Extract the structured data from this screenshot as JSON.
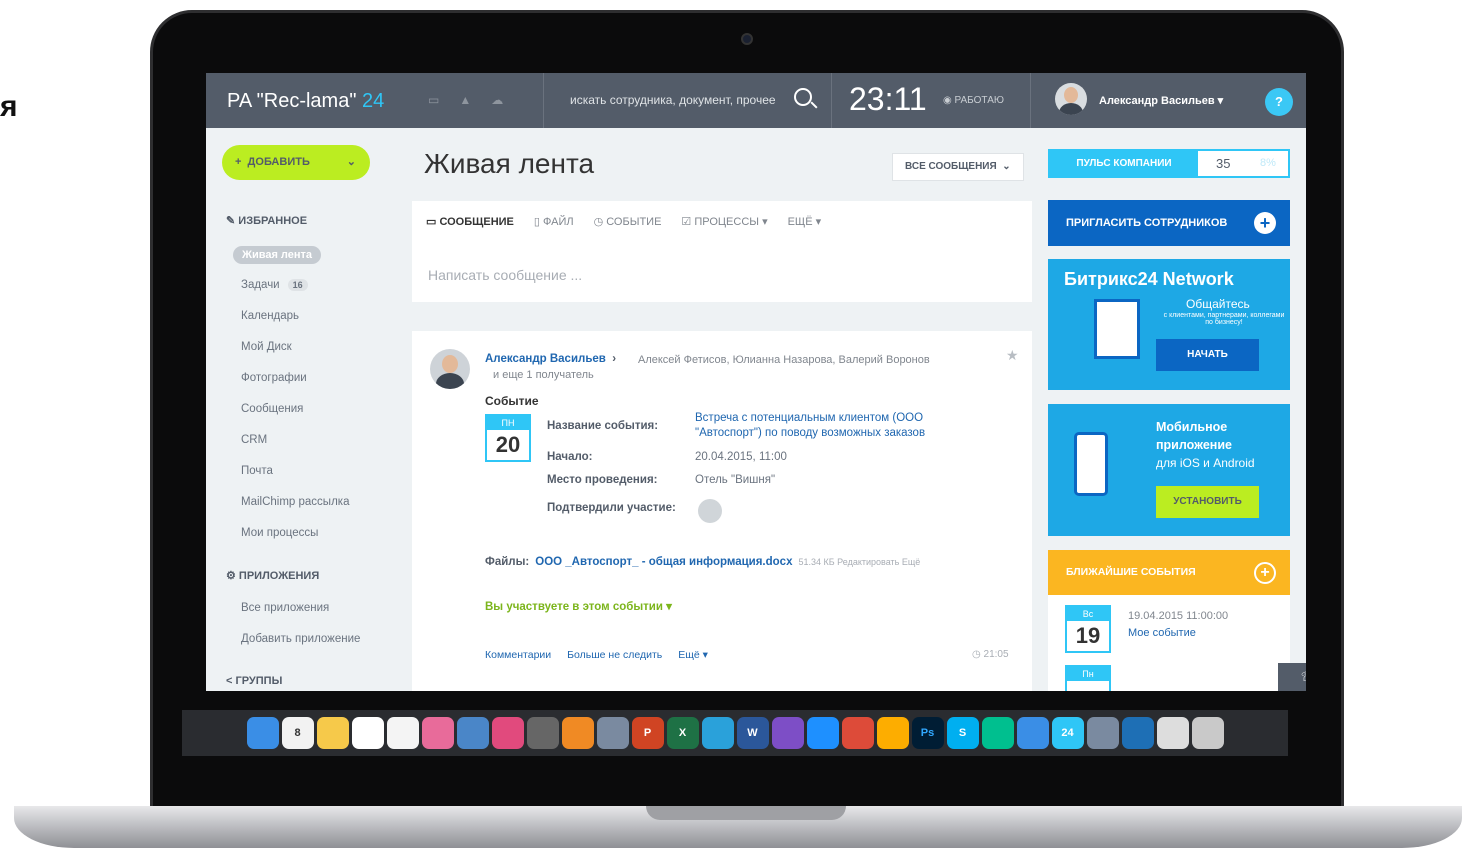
{
  "edge_text": "я",
  "topbar": {
    "brand": "PA \"Rec-lama\"",
    "brand_num": "24",
    "search_placeholder": "искать сотрудника, документ, прочее",
    "clock": "23:11",
    "status": "РАБОТАЮ",
    "user": "Александр Васильев",
    "help": "?"
  },
  "sidebar": {
    "add_label": "ДОБАВИТЬ",
    "favorites": "ИЗБРАННОЕ",
    "active_item": "Живая лента",
    "items": [
      {
        "label": "Задачи",
        "badge": "16"
      },
      {
        "label": "Календарь"
      },
      {
        "label": "Мой Диск"
      },
      {
        "label": "Фотографии"
      },
      {
        "label": "Сообщения"
      },
      {
        "label": "CRM"
      },
      {
        "label": "Почта"
      },
      {
        "label": "MailChimp рассылка"
      },
      {
        "label": "Мои процессы"
      }
    ],
    "apps_head": "ПРИЛОЖЕНИЯ",
    "apps_items": [
      "Все приложения",
      "Добавить приложение"
    ],
    "groups_head": "ГРУППЫ"
  },
  "main": {
    "title": "Живая лента",
    "filter": "ВСЕ СООБЩЕНИЯ",
    "tabs": [
      "СООБЩЕНИЕ",
      "ФАЙЛ",
      "СОБЫТИЕ",
      "ПРОЦЕССЫ",
      "ЕЩЁ"
    ],
    "placeholder": "Написать сообщение ..."
  },
  "post": {
    "author": "Александр Васильев",
    "recipients": "Алексей Фетисов, Юлианна Назарова, Валерий Воронов",
    "recipients_more": "и еще 1 получатель",
    "type": "Событие",
    "cal_dow": "ПН",
    "cal_day": "20",
    "name_label": "Название события:",
    "name_value": "Встреча с потенциальным клиентом (ООО \"Автоспорт\") по поводу возможных заказов",
    "start_label": "Начало:",
    "start_value": "20.04.2015, 11:00",
    "place_label": "Место проведения:",
    "place_value": "Отель \"Вишня\"",
    "confirmed_label": "Подтвердили участие:",
    "files_label": "Файлы:",
    "file_name": "ООО _Автоспорт_ - общая информация.docx",
    "file_meta": "51.34 КБ  Редактировать  Ещё",
    "participate": "Вы участвуете в этом событии",
    "actions": [
      "Комментарии",
      "Больше не следить",
      "Ещё"
    ],
    "time": "21:05"
  },
  "right": {
    "pulse_label": "ПУЛЬС КОМПАНИИ",
    "pulse_value": "35",
    "pulse_percent": "8%",
    "invite": "ПРИГЛАСИТЬ СОТРУДНИКОВ",
    "network_title": "Битрикс24 Network",
    "network_sub": "Общайтесь",
    "network_desc": "с клиентами, партнерами, коллегами по бизнесу!",
    "network_btn": "НАЧАТЬ",
    "mobile_title": "Мобильное приложение",
    "mobile_sub": "для iOS и Android",
    "mobile_btn": "УСТАНОВИТЬ",
    "events_label": "БЛИЖАЙШИЕ СОБЫТИЯ",
    "event_dow": "Вс",
    "event_day": "19",
    "event_date": "19.04.2015 11:00:00",
    "event_name": "Мое событие",
    "next_dow": "Пн"
  },
  "dock": [
    "Finder",
    "8",
    "Notes",
    "Docs",
    "Rem",
    "Photos",
    "Preview",
    "iTunes",
    "Settings",
    "Books",
    "Rocket",
    "P",
    "X",
    "Telegram",
    "W",
    "Viber",
    "Safari",
    "Chrome",
    "Sketch",
    "Ps",
    "S",
    "Vine",
    "Play",
    "24",
    "Preview2",
    "Globe",
    "Finder2",
    "Trash"
  ],
  "colors": {
    "accent": "#2fc6f6",
    "topbar": "#535c69",
    "add": "#bbed21",
    "invite": "#0b66c3",
    "events": "#fbb621"
  }
}
